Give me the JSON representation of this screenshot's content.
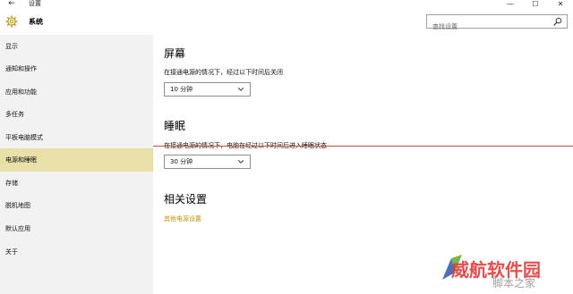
{
  "window": {
    "title": "设置",
    "back_glyph": "←",
    "minimize_glyph": "—",
    "maximize_glyph": "☐",
    "close_glyph": "✕"
  },
  "header": {
    "section_title": "系统",
    "search_placeholder": "查找设置"
  },
  "sidebar": {
    "items": [
      {
        "label": "显示"
      },
      {
        "label": "通知和操作"
      },
      {
        "label": "应用和功能"
      },
      {
        "label": "多任务"
      },
      {
        "label": "平板电脑模式"
      },
      {
        "label": "电源和睡眠",
        "active": true
      },
      {
        "label": "存储"
      },
      {
        "label": "脱机地图"
      },
      {
        "label": "默认应用"
      },
      {
        "label": "关于"
      }
    ]
  },
  "main": {
    "screen": {
      "heading": "屏幕",
      "description": "在接通电源的情况下，经过以下时间后关闭",
      "value": "10 分钟"
    },
    "sleep": {
      "heading": "睡眠",
      "description": "在接通电源的情况下，电脑在经过以下时间后进入睡眠状态",
      "value": "30 分钟"
    },
    "related": {
      "heading": "相关设置",
      "link": "其他电源设置"
    }
  },
  "watermark": {
    "main": "威航软件园",
    "sub": "脚本之家"
  },
  "colors": {
    "sidebar_bg": "#f2f2f2",
    "active_bg": "#e8dfa9",
    "link": "#b8960a",
    "overlay_line": "#d04a4a",
    "watermark": "#e03030"
  }
}
